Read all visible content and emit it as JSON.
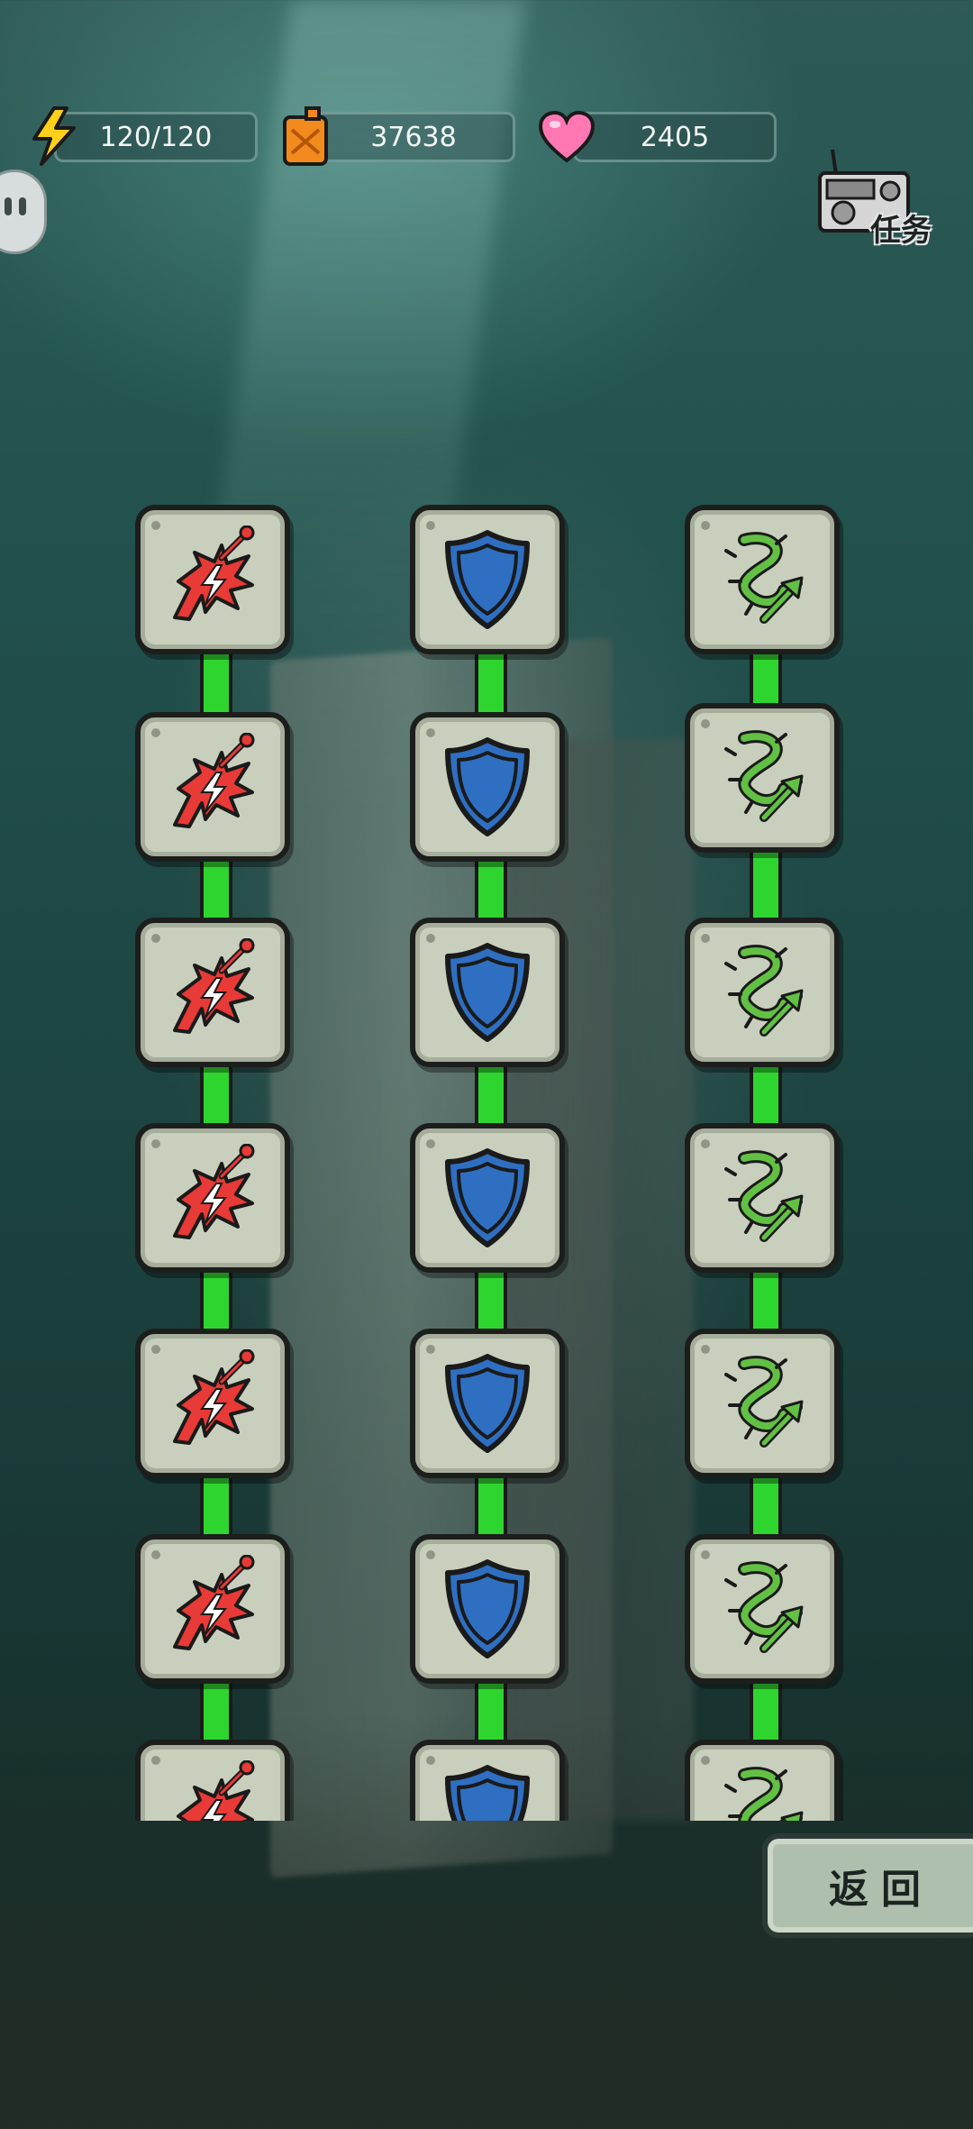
{
  "resources": {
    "energy": {
      "value": "120/120",
      "icon": "lightning-icon"
    },
    "fuel": {
      "value": "37638",
      "icon": "fuel-can-icon"
    },
    "hearts": {
      "value": "2405",
      "icon": "heart-icon"
    }
  },
  "task_button": {
    "label": "任务",
    "icon": "radio-icon"
  },
  "chat_icon": "chat-bubble-icon",
  "skill_columns": [
    {
      "name": "attack",
      "icon": "red-lightning-spear-icon",
      "nodes_visible": 7
    },
    {
      "name": "defense",
      "icon": "blue-shield-icon",
      "nodes_visible": 7
    },
    {
      "name": "growth",
      "icon": "green-vine-arrow-icon",
      "nodes_visible": 7
    }
  ],
  "back_button": {
    "label": "返回"
  },
  "colors": {
    "connector": "#2fd52f",
    "tile": "#c9cfbd",
    "attack": "#e83a36",
    "defense": "#2e6fc2",
    "growth": "#62c044"
  }
}
